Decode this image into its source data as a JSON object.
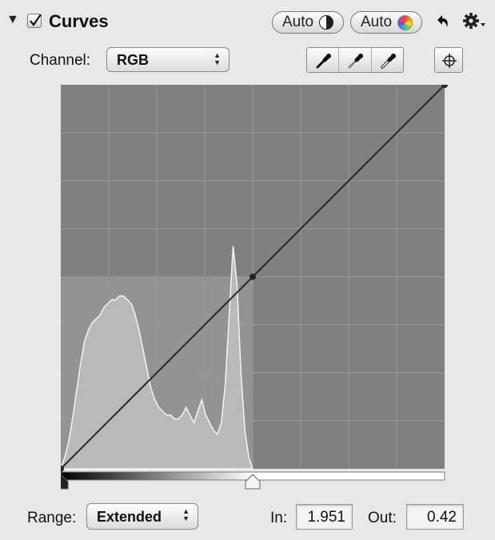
{
  "panel": {
    "title": "Curves",
    "enabled": true,
    "auto_bw_label": "Auto",
    "auto_color_label": "Auto",
    "icons": {
      "disclosure": "disclosure-triangle-icon",
      "checkbox": "checkbox-checked-icon",
      "auto_bw": "half-circle-icon",
      "auto_color": "color-wheel-icon",
      "reset": "reset-arrow-icon",
      "gear": "gear-menu-icon",
      "black_point": "black-eyedropper-icon",
      "gray_point": "gray-eyedropper-icon",
      "white_point": "white-eyedropper-icon",
      "crosshair": "crosshair-icon"
    }
  },
  "channel": {
    "label": "Channel:",
    "value": "RGB"
  },
  "curve": {
    "grid_divisions": 8,
    "control_points": [
      [
        0,
        0
      ],
      [
        0.5,
        0.5
      ],
      [
        1,
        1
      ]
    ],
    "selected_point": [
      0.5,
      0.5
    ],
    "histogram": [
      0,
      0.03,
      0.07,
      0.13,
      0.2,
      0.27,
      0.33,
      0.36,
      0.38,
      0.39,
      0.4,
      0.42,
      0.43,
      0.44,
      0.44,
      0.45,
      0.45,
      0.44,
      0.43,
      0.4,
      0.36,
      0.31,
      0.26,
      0.21,
      0.18,
      0.16,
      0.15,
      0.14,
      0.14,
      0.13,
      0.13,
      0.14,
      0.16,
      0.14,
      0.12,
      0.15,
      0.18,
      0.14,
      0.12,
      0.1,
      0.09,
      0.12,
      0.22,
      0.4,
      0.58,
      0.48,
      0.25,
      0.1,
      0.03,
      0
    ]
  },
  "range": {
    "label": "Range:",
    "value": "Extended",
    "black_handle": 0,
    "white_handle": 0.5
  },
  "readout": {
    "in_label": "In:",
    "in_value": "1.951",
    "out_label": "Out:",
    "out_value": "0.42"
  },
  "colors": {
    "graph_bg": "#808080",
    "graph_region_light": "#939393",
    "grid": "#9a9a9a",
    "histogram": "#b9b9b9",
    "histogram_outline": "#f4f4f4",
    "curve": "#262626"
  }
}
